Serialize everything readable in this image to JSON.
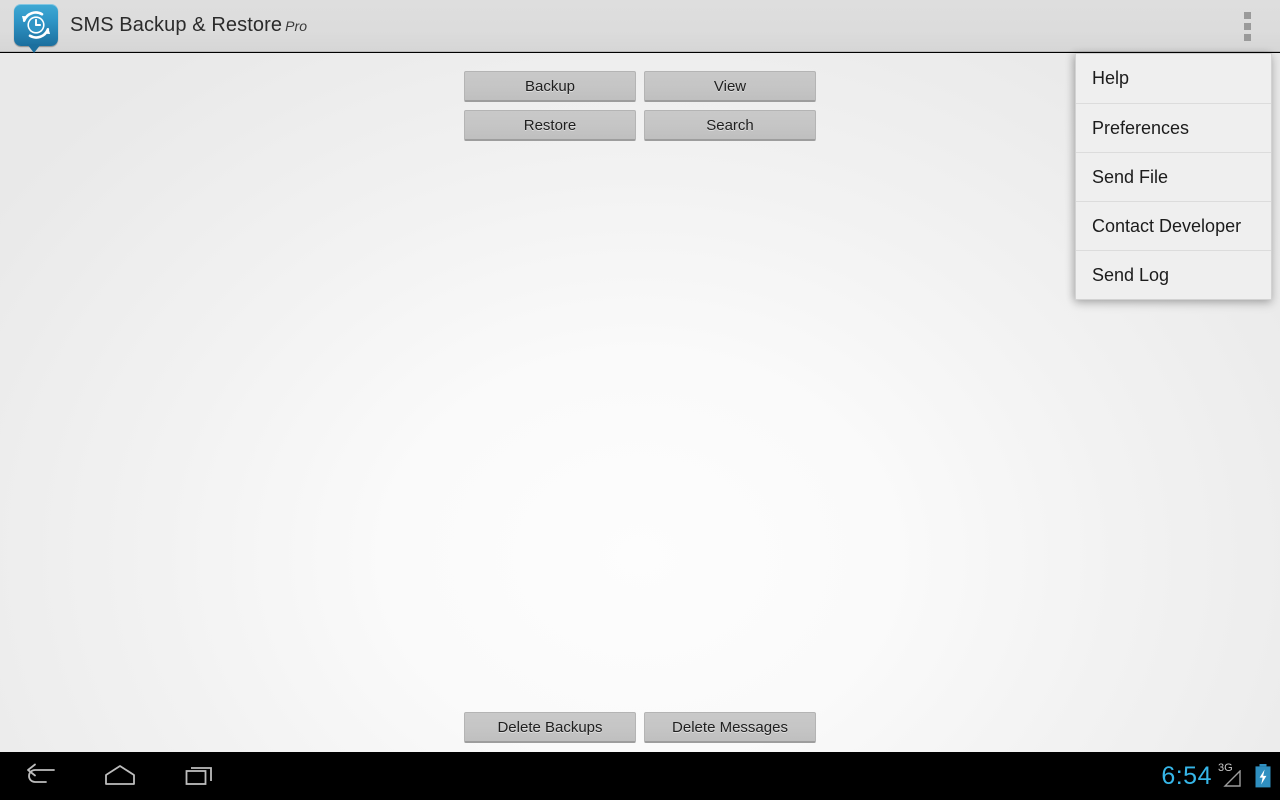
{
  "app": {
    "title": "SMS Backup & Restore",
    "title_suffix": "Pro",
    "icon_name": "sms-backup-restore-app-icon"
  },
  "action_bar": {
    "overflow_icon": "overflow-menu-icon"
  },
  "main": {
    "top_buttons": [
      {
        "label": "Backup"
      },
      {
        "label": "View"
      },
      {
        "label": "Restore"
      },
      {
        "label": "Search"
      }
    ],
    "bottom_buttons": [
      {
        "label": "Delete Backups"
      },
      {
        "label": "Delete Messages"
      }
    ]
  },
  "overflow_menu": {
    "visible": true,
    "items": [
      {
        "label": "Help"
      },
      {
        "label": "Preferences"
      },
      {
        "label": "Send File"
      },
      {
        "label": "Contact Developer"
      },
      {
        "label": "Send Log"
      }
    ]
  },
  "navbar": {
    "back_icon": "back-arrow-icon",
    "home_icon": "home-icon",
    "recents_icon": "recent-apps-icon",
    "clock": "6:54",
    "network_label": "3G",
    "signal_icon": "signal-triangle-icon",
    "battery_icon": "battery-charging-icon"
  },
  "colors": {
    "accent": "#36b6e8",
    "action_bar_bg": "#dcdcdc",
    "button_bg": "#c5c5c5",
    "menu_bg": "#efefef",
    "navbar_bg": "#000000"
  }
}
